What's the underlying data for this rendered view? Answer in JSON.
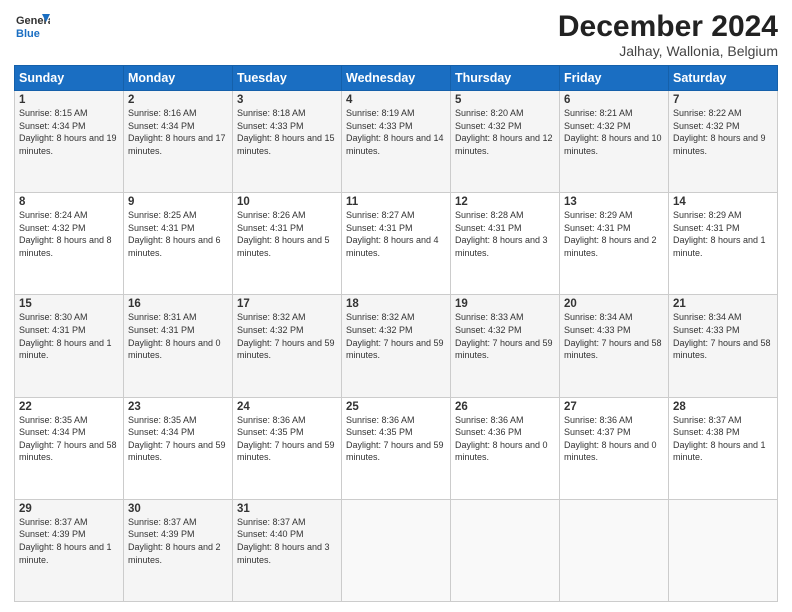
{
  "header": {
    "logo_line1": "General",
    "logo_line2": "Blue",
    "month_title": "December 2024",
    "location": "Jalhay, Wallonia, Belgium"
  },
  "days_of_week": [
    "Sunday",
    "Monday",
    "Tuesday",
    "Wednesday",
    "Thursday",
    "Friday",
    "Saturday"
  ],
  "weeks": [
    [
      {
        "day": "1",
        "sunrise": "8:15 AM",
        "sunset": "4:34 PM",
        "daylight": "8 hours and 19 minutes."
      },
      {
        "day": "2",
        "sunrise": "8:16 AM",
        "sunset": "4:34 PM",
        "daylight": "8 hours and 17 minutes."
      },
      {
        "day": "3",
        "sunrise": "8:18 AM",
        "sunset": "4:33 PM",
        "daylight": "8 hours and 15 minutes."
      },
      {
        "day": "4",
        "sunrise": "8:19 AM",
        "sunset": "4:33 PM",
        "daylight": "8 hours and 14 minutes."
      },
      {
        "day": "5",
        "sunrise": "8:20 AM",
        "sunset": "4:32 PM",
        "daylight": "8 hours and 12 minutes."
      },
      {
        "day": "6",
        "sunrise": "8:21 AM",
        "sunset": "4:32 PM",
        "daylight": "8 hours and 10 minutes."
      },
      {
        "day": "7",
        "sunrise": "8:22 AM",
        "sunset": "4:32 PM",
        "daylight": "8 hours and 9 minutes."
      }
    ],
    [
      {
        "day": "8",
        "sunrise": "8:24 AM",
        "sunset": "4:32 PM",
        "daylight": "8 hours and 8 minutes."
      },
      {
        "day": "9",
        "sunrise": "8:25 AM",
        "sunset": "4:31 PM",
        "daylight": "8 hours and 6 minutes."
      },
      {
        "day": "10",
        "sunrise": "8:26 AM",
        "sunset": "4:31 PM",
        "daylight": "8 hours and 5 minutes."
      },
      {
        "day": "11",
        "sunrise": "8:27 AM",
        "sunset": "4:31 PM",
        "daylight": "8 hours and 4 minutes."
      },
      {
        "day": "12",
        "sunrise": "8:28 AM",
        "sunset": "4:31 PM",
        "daylight": "8 hours and 3 minutes."
      },
      {
        "day": "13",
        "sunrise": "8:29 AM",
        "sunset": "4:31 PM",
        "daylight": "8 hours and 2 minutes."
      },
      {
        "day": "14",
        "sunrise": "8:29 AM",
        "sunset": "4:31 PM",
        "daylight": "8 hours and 1 minute."
      }
    ],
    [
      {
        "day": "15",
        "sunrise": "8:30 AM",
        "sunset": "4:31 PM",
        "daylight": "8 hours and 1 minute."
      },
      {
        "day": "16",
        "sunrise": "8:31 AM",
        "sunset": "4:31 PM",
        "daylight": "8 hours and 0 minutes."
      },
      {
        "day": "17",
        "sunrise": "8:32 AM",
        "sunset": "4:32 PM",
        "daylight": "7 hours and 59 minutes."
      },
      {
        "day": "18",
        "sunrise": "8:32 AM",
        "sunset": "4:32 PM",
        "daylight": "7 hours and 59 minutes."
      },
      {
        "day": "19",
        "sunrise": "8:33 AM",
        "sunset": "4:32 PM",
        "daylight": "7 hours and 59 minutes."
      },
      {
        "day": "20",
        "sunrise": "8:34 AM",
        "sunset": "4:33 PM",
        "daylight": "7 hours and 58 minutes."
      },
      {
        "day": "21",
        "sunrise": "8:34 AM",
        "sunset": "4:33 PM",
        "daylight": "7 hours and 58 minutes."
      }
    ],
    [
      {
        "day": "22",
        "sunrise": "8:35 AM",
        "sunset": "4:34 PM",
        "daylight": "7 hours and 58 minutes."
      },
      {
        "day": "23",
        "sunrise": "8:35 AM",
        "sunset": "4:34 PM",
        "daylight": "7 hours and 59 minutes."
      },
      {
        "day": "24",
        "sunrise": "8:36 AM",
        "sunset": "4:35 PM",
        "daylight": "7 hours and 59 minutes."
      },
      {
        "day": "25",
        "sunrise": "8:36 AM",
        "sunset": "4:35 PM",
        "daylight": "7 hours and 59 minutes."
      },
      {
        "day": "26",
        "sunrise": "8:36 AM",
        "sunset": "4:36 PM",
        "daylight": "8 hours and 0 minutes."
      },
      {
        "day": "27",
        "sunrise": "8:36 AM",
        "sunset": "4:37 PM",
        "daylight": "8 hours and 0 minutes."
      },
      {
        "day": "28",
        "sunrise": "8:37 AM",
        "sunset": "4:38 PM",
        "daylight": "8 hours and 1 minute."
      }
    ],
    [
      {
        "day": "29",
        "sunrise": "8:37 AM",
        "sunset": "4:39 PM",
        "daylight": "8 hours and 1 minute."
      },
      {
        "day": "30",
        "sunrise": "8:37 AM",
        "sunset": "4:39 PM",
        "daylight": "8 hours and 2 minutes."
      },
      {
        "day": "31",
        "sunrise": "8:37 AM",
        "sunset": "4:40 PM",
        "daylight": "8 hours and 3 minutes."
      },
      null,
      null,
      null,
      null
    ]
  ]
}
